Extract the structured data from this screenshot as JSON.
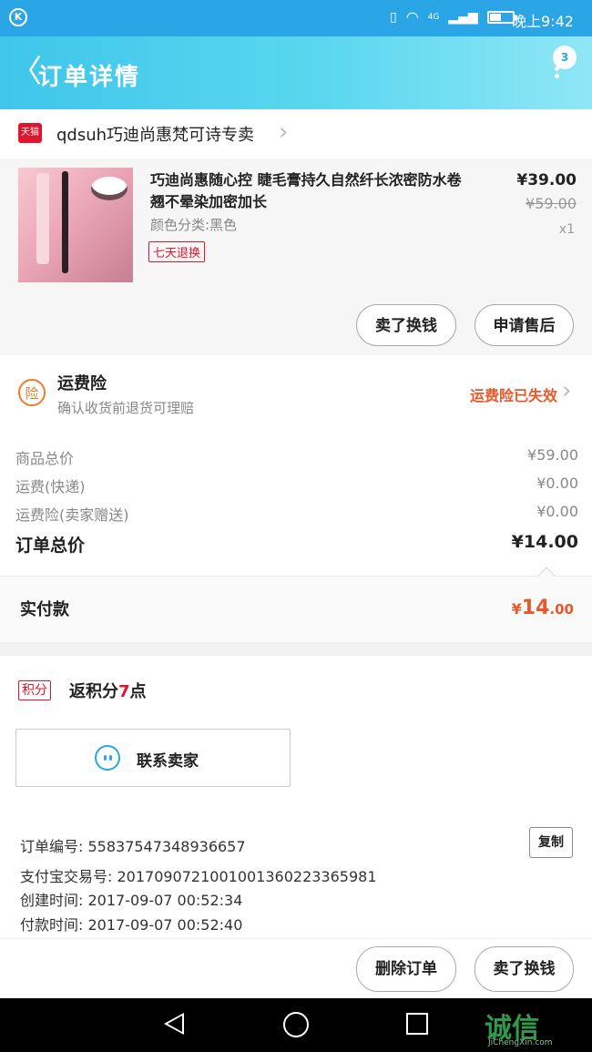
{
  "status_bar": {
    "time": "晚上9:42",
    "network": "4G"
  },
  "header": {
    "title": "订单详情",
    "badge": "3"
  },
  "store": {
    "tag": "天猫",
    "name": "qdsuh巧迪尚惠梵可诗专卖"
  },
  "product": {
    "name": "巧迪尚惠随心控 睫毛膏持久自然纤长浓密防水卷翘不晕染加密加长",
    "variant": "颜色分类:黑色",
    "tag": "七天退换",
    "price": "¥39.00",
    "original_price": "¥59.00",
    "quantity": "x1",
    "actions": [
      "卖了换钱",
      "申请售后"
    ]
  },
  "insurance": {
    "icon": "险",
    "title": "运费险",
    "subtitle": "确认收货前退货可理赔",
    "status": "运费险已失效"
  },
  "summary": {
    "rows": [
      {
        "label": "商品总价",
        "value": "¥59.00"
      },
      {
        "label": "运费(快递)",
        "value": "¥0.00"
      },
      {
        "label": "运费险(卖家赠送)",
        "value": "¥0.00"
      }
    ],
    "total_label": "订单总价",
    "total_value": "¥14.00",
    "paid_label": "实付款",
    "paid_symbol": "¥",
    "paid_main": "14",
    "paid_cents": ".00"
  },
  "points": {
    "tag": "积分",
    "text_prefix": "返积分",
    "count": "7",
    "text_suffix": "点"
  },
  "contact": {
    "label": "联系卖家"
  },
  "order_info": {
    "order_no": "订单编号: 55837547348936657",
    "alipay_no": "支付宝交易号: 2017090721001001360223365981",
    "created": "创建时间: 2017-09-07 00:52:34",
    "paid": "付款时间: 2017-09-07 00:52:40",
    "copy_label": "复制"
  },
  "footer": {
    "delete_label": "删除订单",
    "resell_label": "卖了换钱"
  },
  "watermark": {
    "text": "诚信",
    "sub": "JiChengXin.com"
  },
  "colors": {
    "header": "#3fc6ea",
    "accent_red": "#e0152f",
    "orange": "#e8582a"
  }
}
